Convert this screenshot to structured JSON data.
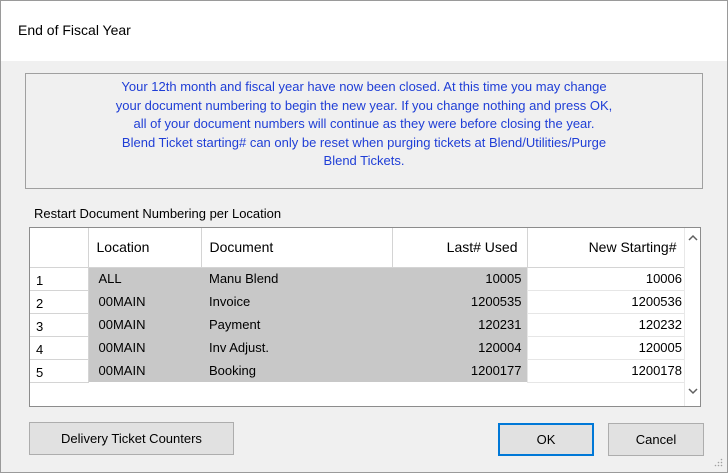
{
  "window": {
    "title": "End of Fiscal Year"
  },
  "info": {
    "lines": [
      "Your 12th month and fiscal year have now been closed. At this time you may change",
      "your document numbering to begin the new year.  If you change nothing and press OK,",
      "all of your document numbers will continue as they were before closing the year.",
      "Blend Ticket starting# can only be reset when purging tickets at Blend/Utilities/Purge",
      "Blend Tickets."
    ]
  },
  "section_label": "Restart Document Numbering per Location",
  "grid": {
    "columns": {
      "location": "Location",
      "document": "Document",
      "last_used": "Last# Used",
      "new_starting": "New Starting#"
    },
    "rows": [
      {
        "num": "1",
        "location": "ALL",
        "document": "Manu Blend",
        "last_used": "10005",
        "new_starting": "10006"
      },
      {
        "num": "2",
        "location": "00MAIN",
        "document": "Invoice",
        "last_used": "1200535",
        "new_starting": "1200536"
      },
      {
        "num": "3",
        "location": "00MAIN",
        "document": "Payment",
        "last_used": "120231",
        "new_starting": "120232"
      },
      {
        "num": "4",
        "location": "00MAIN",
        "document": "Inv Adjust.",
        "last_used": "120004",
        "new_starting": "120005"
      },
      {
        "num": "5",
        "location": "00MAIN",
        "document": "Booking",
        "last_used": "1200177",
        "new_starting": "1200178"
      }
    ]
  },
  "buttons": {
    "delivery": "Delivery Ticket Counters",
    "ok": "OK",
    "cancel": "Cancel"
  },
  "icons": {
    "scroll_up": "chevron-up-icon",
    "scroll_down": "chevron-down-icon",
    "resize_grip": "resize-grip-icon"
  },
  "colors": {
    "info_text": "#1f3ed6",
    "readonly_cell": "#c8c8c8",
    "focus_border": "#0078d7"
  }
}
